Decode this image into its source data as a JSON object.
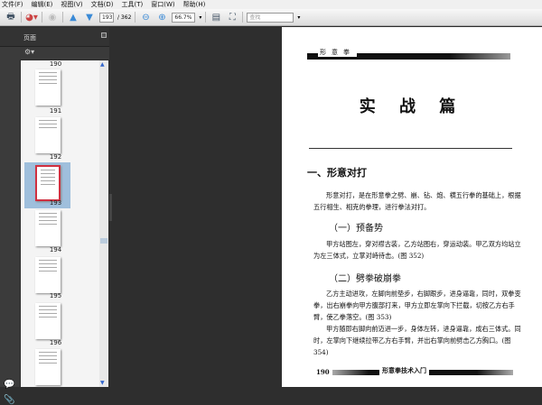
{
  "menu": [
    "文件(F)",
    "编辑(E)",
    "视图(V)",
    "文档(D)",
    "工具(T)",
    "窗口(W)",
    "帮助(H)"
  ],
  "toolbar": {
    "page_current": "193",
    "page_total": "/ 362",
    "zoom": "66.7%",
    "search_placeholder": "查找"
  },
  "panel": {
    "title": "页面",
    "thumbnails": [
      {
        "label": "190"
      },
      {
        "label": "191"
      },
      {
        "label": "192"
      },
      {
        "label": "193",
        "selected": true
      },
      {
        "label": "194"
      },
      {
        "label": "195"
      },
      {
        "label": "196"
      }
    ]
  },
  "document": {
    "running_head": "形意拳",
    "title": "实 战 篇",
    "section": "一、形意对打",
    "intro": "形意对打，是在形意拳之劈、崩、钻、炮、横五行拳的基础上，根据五行相生、相克的拳理，进行拳法对打。",
    "sub1": "（一）预备势",
    "p1": "甲方站图左，穿对襟古装，乙方站图右，穿运动装。甲乙双方均站立为左三体式，立掌对峙待击。(图 352)",
    "sub2": "（二）劈拳破崩拳",
    "p2": "乙方主动进攻，左脚向前垫步，右脚跟步，进身逼靠，同时，双拳变拳，出右崩拳向甲方腹部打来，甲方立即左掌向下拦截，切按乙方右手臂，使乙拳落空。(图 353)",
    "p3": "甲方随即右脚向前迈进一步，身体左转，进身逼靠，成右三体式。同时，左掌向下继续拉带乙方右手臂，并出右掌向前劈击乙方胸口。(图 354)",
    "footer_page": "190",
    "footer_title": "形意拳技术入门"
  },
  "colors": {
    "selected_thumb": "#9fbfdc",
    "selected_border": "#d03040",
    "viewer_bg": "#2e2e2e"
  }
}
